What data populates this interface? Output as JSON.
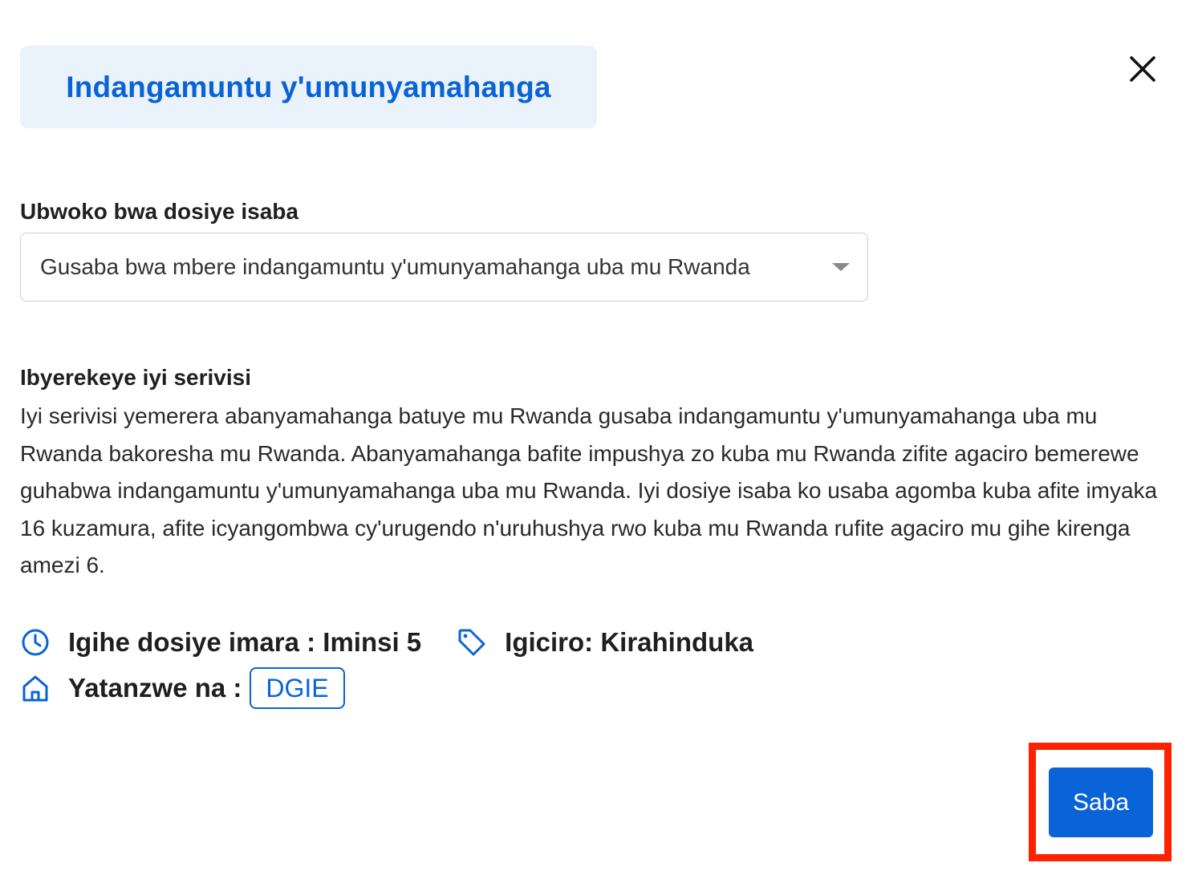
{
  "dialog": {
    "title": "Indangamuntu y'umunyamahanga",
    "close_icon": "close-icon"
  },
  "application_type": {
    "label": "Ubwoko bwa dosiye isaba",
    "selected_value": "Gusaba bwa mbere indangamuntu y'umunyamahanga uba mu Rwanda",
    "dropdown_icon": "caret-down-icon"
  },
  "about": {
    "heading": "Ibyerekeye iyi serivisi",
    "text": "Iyi serivisi yemerera abanyamahanga batuye mu Rwanda gusaba indangamuntu y'umunyamahanga uba mu Rwanda bakoresha mu Rwanda. Abanyamahanga bafite impushya zo kuba mu Rwanda zifite agaciro bemerewe guhabwa indangamuntu y'umunyamahanga uba mu Rwanda. Iyi dosiye isaba ko usaba agomba kuba afite imyaka 16 kuzamura, afite icyangombwa cy'urugendo n'uruhushya rwo kuba mu Rwanda rufite agaciro mu gihe kirenga amezi 6."
  },
  "meta": {
    "processing_time": "Igihe dosiye imara : Iminsi 5",
    "price": "Igiciro: Kirahinduka",
    "provider_label": "Yatanzwe na :",
    "provider": "DGIE",
    "icons": [
      "clock-icon",
      "tag-icon",
      "home-icon"
    ]
  },
  "actions": {
    "submit_label": "Saba"
  },
  "colors": {
    "accent": "#0a63d6",
    "title_bg": "#eaf2fc",
    "highlight": "#ff2200"
  }
}
